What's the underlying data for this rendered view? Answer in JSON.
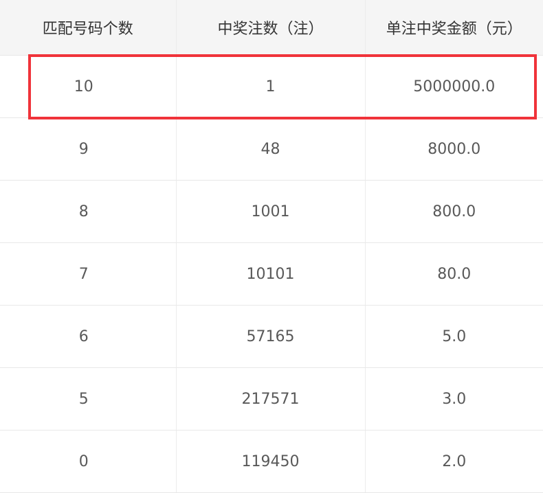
{
  "table": {
    "headers": {
      "match_count": "匹配号码个数",
      "winning_bets": "中奖注数（注）",
      "prize_per_bet": "单注中奖金额（元）"
    },
    "rows": [
      {
        "match_count": "10",
        "winning_bets": "1",
        "prize_per_bet": "5000000.0"
      },
      {
        "match_count": "9",
        "winning_bets": "48",
        "prize_per_bet": "8000.0"
      },
      {
        "match_count": "8",
        "winning_bets": "1001",
        "prize_per_bet": "800.0"
      },
      {
        "match_count": "7",
        "winning_bets": "10101",
        "prize_per_bet": "80.0"
      },
      {
        "match_count": "6",
        "winning_bets": "57165",
        "prize_per_bet": "5.0"
      },
      {
        "match_count": "5",
        "winning_bets": "217571",
        "prize_per_bet": "3.0"
      },
      {
        "match_count": "0",
        "winning_bets": "119450",
        "prize_per_bet": "2.0"
      }
    ]
  },
  "highlight": {
    "row_index": 0,
    "color": "#f0333a"
  }
}
